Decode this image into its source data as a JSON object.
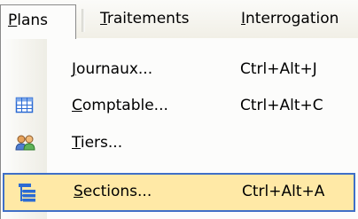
{
  "menubar": {
    "plans": {
      "pre": "",
      "key": "P",
      "post": "lans"
    },
    "traitements": {
      "pre": "",
      "key": "T",
      "post": "raitements"
    },
    "interrogation": {
      "pre": "",
      "key": "I",
      "post": "nterrogation"
    }
  },
  "menu": {
    "items": [
      {
        "key": "J",
        "post": "ournaux...",
        "shortcut": "Ctrl+Alt+J",
        "icon": "none"
      },
      {
        "key": "C",
        "post": "omptable...",
        "shortcut": "Ctrl+Alt+C",
        "icon": "grid-table-icon"
      },
      {
        "key": "T",
        "post": "iers...",
        "shortcut": "",
        "icon": "people-icon"
      },
      {
        "key": "S",
        "post": "ections...",
        "shortcut": "Ctrl+Alt+A",
        "icon": "sections-tree-icon",
        "selected": true
      }
    ]
  },
  "colors": {
    "selection_fill": "#ffe9a6",
    "selection_border": "#3f6fc7",
    "icon_blue": "#2c6bd3"
  }
}
